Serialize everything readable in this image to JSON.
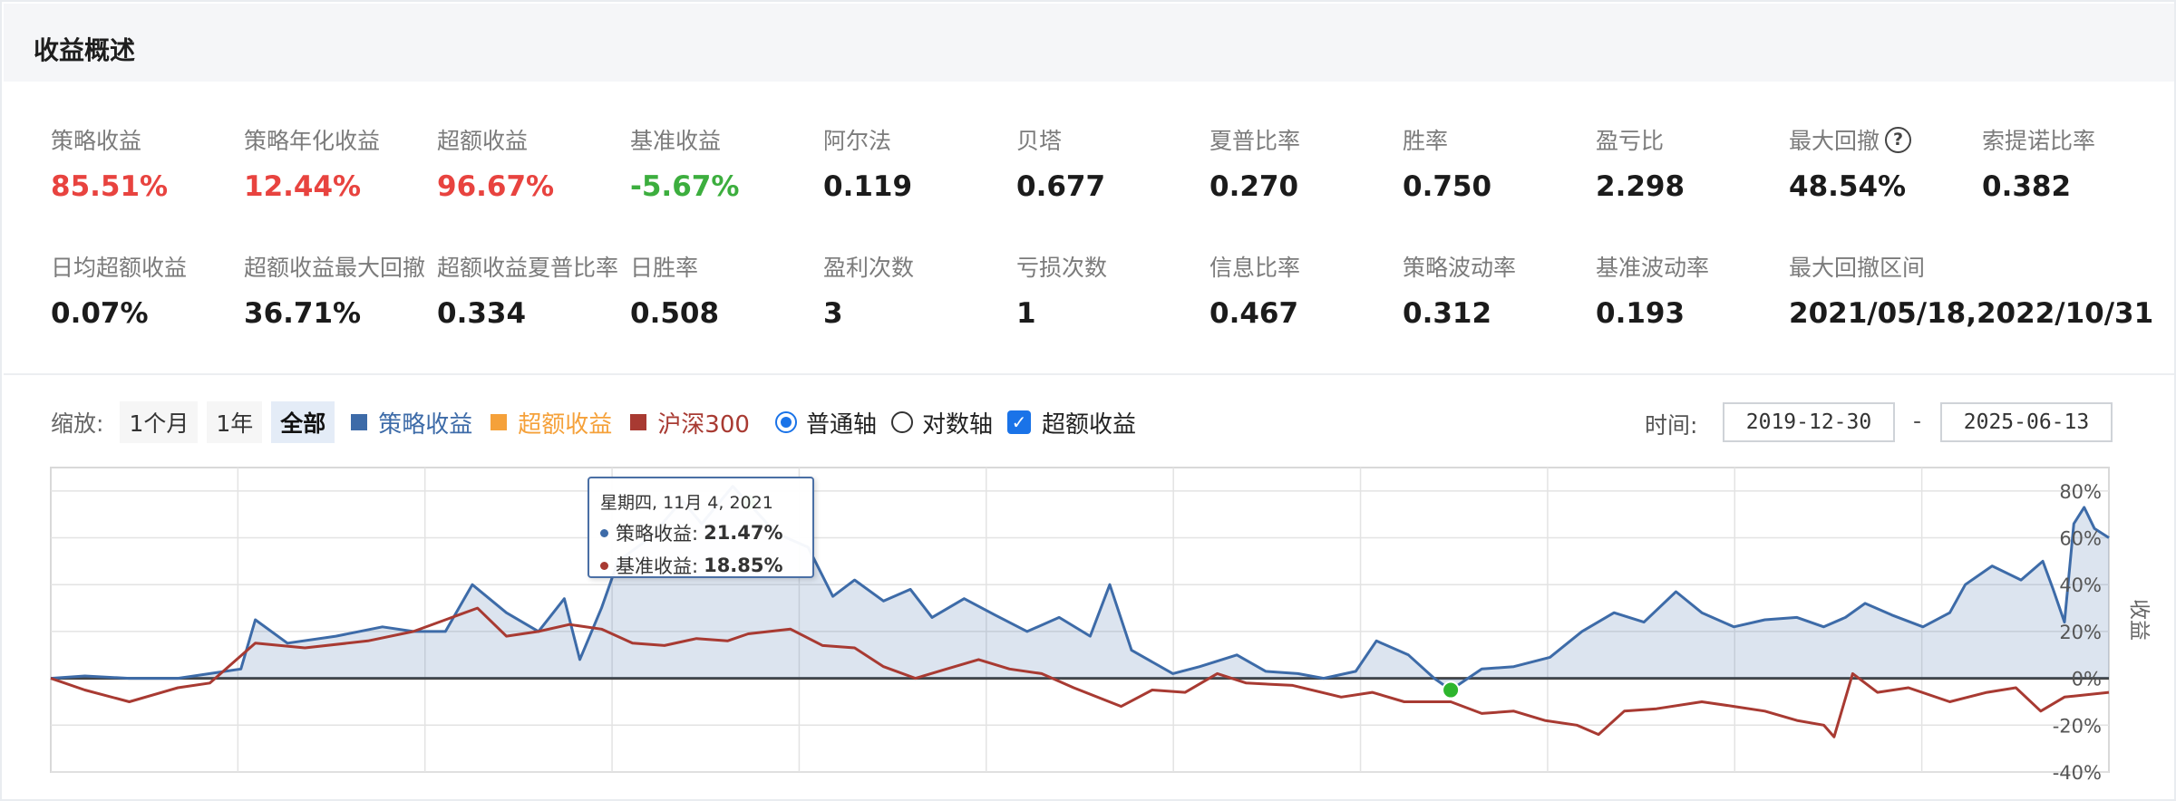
{
  "header": {
    "title": "收益概述"
  },
  "metrics": [
    {
      "label": "策略收益",
      "value": "85.51%"
    },
    {
      "label": "策略年化收益",
      "value": "12.44%"
    },
    {
      "label": "超额收益",
      "value": "96.67%"
    },
    {
      "label": "基准收益",
      "value": "-5.67%"
    },
    {
      "label": "阿尔法",
      "value": "0.119"
    },
    {
      "label": "贝塔",
      "value": "0.677"
    },
    {
      "label": "夏普比率",
      "value": "0.270"
    },
    {
      "label": "胜率",
      "value": "0.750"
    },
    {
      "label": "盈亏比",
      "value": "2.298"
    },
    {
      "label": "最大回撤",
      "value": "48.54%"
    },
    {
      "label": "索提诺比率",
      "value": "0.382"
    },
    {
      "label": "日均超额收益",
      "value": "0.07%"
    },
    {
      "label": "超额收益最大回撤",
      "value": "36.71%"
    },
    {
      "label": "超额收益夏普比率",
      "value": "0.334"
    },
    {
      "label": "日胜率",
      "value": "0.508"
    },
    {
      "label": "盈利次数",
      "value": "3"
    },
    {
      "label": "亏损次数",
      "value": "1"
    },
    {
      "label": "信息比率",
      "value": "0.467"
    },
    {
      "label": "策略波动率",
      "value": "0.312"
    },
    {
      "label": "基准波动率",
      "value": "0.193"
    },
    {
      "label": "最大回撤区间",
      "value": "2021/05/18,2022/10/31"
    }
  ],
  "help_icon_glyph": "?",
  "toolbar": {
    "zoom_label": "缩放:",
    "zoom_buttons": [
      "1个月",
      "1年",
      "全部"
    ],
    "legend": [
      {
        "label": "策略收益",
        "color": "#3d6ba8"
      },
      {
        "label": "超额收益",
        "color": "#f5a13a"
      },
      {
        "label": "沪深300",
        "color": "#a83a32"
      }
    ],
    "axis_normal": "普通轴",
    "axis_log": "对数轴",
    "excess_check": "超额收益",
    "check_glyph": "✓"
  },
  "time_range": {
    "label": "时间:",
    "start": "2019-12-30",
    "end": "2025-06-13",
    "dash": "-"
  },
  "tooltip": {
    "date": "星期四, 11月 4, 2021",
    "rows": [
      {
        "label": "策略收益:",
        "value": "21.47%",
        "color": "#3d6ba8"
      },
      {
        "label": "基准收益:",
        "value": "18.85%",
        "color": "#a83a32"
      }
    ]
  },
  "chart_data": {
    "type": "area",
    "y_axis_label": "收益",
    "ylim": [
      -40,
      90
    ],
    "yticks": [
      "80%",
      "60%",
      "40%",
      "20%",
      "0%",
      "-20%",
      "-40%"
    ],
    "ytick_values": [
      80,
      60,
      40,
      20,
      0,
      -20,
      -40
    ],
    "xlim": [
      "2019-12-30",
      "2025-06-13"
    ],
    "grid": true,
    "series": [
      {
        "name": "策略收益",
        "color": "#3d6ba8",
        "fill": "rgba(61,107,168,0.18)",
        "points": [
          [
            "2019-12-30",
            0
          ],
          [
            "2020-02-01",
            1
          ],
          [
            "2020-03-15",
            0
          ],
          [
            "2020-05-01",
            0
          ],
          [
            "2020-06-01",
            2
          ],
          [
            "2020-07-01",
            4
          ],
          [
            "2020-07-15",
            25
          ],
          [
            "2020-08-15",
            15
          ],
          [
            "2020-10-01",
            18
          ],
          [
            "2020-11-15",
            22
          ],
          [
            "2020-12-15",
            20
          ],
          [
            "2021-01-15",
            20
          ],
          [
            "2021-02-10",
            40
          ],
          [
            "2021-03-15",
            28
          ],
          [
            "2021-04-15",
            20
          ],
          [
            "2021-05-10",
            34
          ],
          [
            "2021-05-25",
            8
          ],
          [
            "2021-06-15",
            30
          ],
          [
            "2021-07-01",
            50
          ],
          [
            "2021-08-01",
            60
          ],
          [
            "2021-09-01",
            76
          ],
          [
            "2021-09-20",
            66
          ],
          [
            "2021-10-20",
            82
          ],
          [
            "2021-11-04",
            75
          ],
          [
            "2021-12-01",
            62
          ],
          [
            "2022-01-01",
            56
          ],
          [
            "2022-01-25",
            35
          ],
          [
            "2022-02-15",
            42
          ],
          [
            "2022-03-15",
            33
          ],
          [
            "2022-04-10",
            38
          ],
          [
            "2022-05-01",
            26
          ],
          [
            "2022-06-01",
            34
          ],
          [
            "2022-07-01",
            27
          ],
          [
            "2022-08-01",
            20
          ],
          [
            "2022-09-01",
            26
          ],
          [
            "2022-10-01",
            18
          ],
          [
            "2022-10-20",
            40
          ],
          [
            "2022-11-10",
            12
          ],
          [
            "2022-12-20",
            2
          ],
          [
            "2023-01-15",
            5
          ],
          [
            "2023-02-20",
            10
          ],
          [
            "2023-03-20",
            3
          ],
          [
            "2023-04-20",
            2
          ],
          [
            "2023-05-15",
            0
          ],
          [
            "2023-06-15",
            3
          ],
          [
            "2023-07-05",
            16
          ],
          [
            "2023-08-05",
            10
          ],
          [
            "2023-08-30",
            0
          ],
          [
            "2023-09-15",
            -5
          ],
          [
            "2023-10-15",
            4
          ],
          [
            "2023-11-15",
            5
          ],
          [
            "2023-12-20",
            9
          ],
          [
            "2024-01-20",
            20
          ],
          [
            "2024-02-20",
            28
          ],
          [
            "2024-03-20",
            24
          ],
          [
            "2024-04-20",
            37
          ],
          [
            "2024-05-15",
            28
          ],
          [
            "2024-06-15",
            22
          ],
          [
            "2024-07-15",
            25
          ],
          [
            "2024-08-15",
            26
          ],
          [
            "2024-09-10",
            22
          ],
          [
            "2024-10-01",
            26
          ],
          [
            "2024-10-20",
            32
          ],
          [
            "2024-11-15",
            27
          ],
          [
            "2024-12-15",
            22
          ],
          [
            "2025-01-10",
            28
          ],
          [
            "2025-01-25",
            40
          ],
          [
            "2025-02-20",
            48
          ],
          [
            "2025-03-20",
            42
          ],
          [
            "2025-04-10",
            50
          ],
          [
            "2025-04-20",
            38
          ],
          [
            "2025-05-01",
            24
          ],
          [
            "2025-05-10",
            66
          ],
          [
            "2025-05-20",
            73
          ],
          [
            "2025-05-30",
            64
          ],
          [
            "2025-06-13",
            60
          ]
        ]
      },
      {
        "name": "沪深300",
        "color": "#a83a32",
        "points": [
          [
            "2019-12-30",
            0
          ],
          [
            "2020-02-01",
            -5
          ],
          [
            "2020-03-15",
            -10
          ],
          [
            "2020-05-01",
            -4
          ],
          [
            "2020-06-01",
            -2
          ],
          [
            "2020-07-15",
            15
          ],
          [
            "2020-09-01",
            13
          ],
          [
            "2020-11-01",
            16
          ],
          [
            "2020-12-15",
            20
          ],
          [
            "2021-01-15",
            25
          ],
          [
            "2021-02-15",
            30
          ],
          [
            "2021-03-15",
            18
          ],
          [
            "2021-04-15",
            20
          ],
          [
            "2021-05-15",
            23
          ],
          [
            "2021-06-15",
            21
          ],
          [
            "2021-07-15",
            15
          ],
          [
            "2021-08-15",
            14
          ],
          [
            "2021-09-15",
            17
          ],
          [
            "2021-10-15",
            16
          ],
          [
            "2021-11-04",
            19
          ],
          [
            "2021-12-15",
            21
          ],
          [
            "2022-01-15",
            14
          ],
          [
            "2022-02-15",
            13
          ],
          [
            "2022-03-15",
            5
          ],
          [
            "2022-04-15",
            0
          ],
          [
            "2022-05-15",
            4
          ],
          [
            "2022-06-15",
            8
          ],
          [
            "2022-07-15",
            4
          ],
          [
            "2022-08-15",
            2
          ],
          [
            "2022-09-15",
            -4
          ],
          [
            "2022-10-31",
            -12
          ],
          [
            "2022-11-30",
            -5
          ],
          [
            "2023-01-01",
            -6
          ],
          [
            "2023-02-01",
            2
          ],
          [
            "2023-03-01",
            -2
          ],
          [
            "2023-04-15",
            -3
          ],
          [
            "2023-06-01",
            -8
          ],
          [
            "2023-07-01",
            -6
          ],
          [
            "2023-08-01",
            -10
          ],
          [
            "2023-09-15",
            -10
          ],
          [
            "2023-10-15",
            -15
          ],
          [
            "2023-11-15",
            -14
          ],
          [
            "2023-12-15",
            -18
          ],
          [
            "2024-01-15",
            -20
          ],
          [
            "2024-02-05",
            -24
          ],
          [
            "2024-03-01",
            -14
          ],
          [
            "2024-04-01",
            -13
          ],
          [
            "2024-05-15",
            -10
          ],
          [
            "2024-06-15",
            -12
          ],
          [
            "2024-07-15",
            -14
          ],
          [
            "2024-08-15",
            -18
          ],
          [
            "2024-09-10",
            -20
          ],
          [
            "2024-09-20",
            -25
          ],
          [
            "2024-10-08",
            2
          ],
          [
            "2024-11-01",
            -6
          ],
          [
            "2024-12-01",
            -4
          ],
          [
            "2025-01-10",
            -10
          ],
          [
            "2025-02-15",
            -6
          ],
          [
            "2025-03-15",
            -4
          ],
          [
            "2025-04-08",
            -14
          ],
          [
            "2025-05-01",
            -8
          ],
          [
            "2025-06-13",
            -6
          ]
        ]
      }
    ],
    "highlight_points": [
      {
        "series": "策略收益",
        "date": "2021-11-04",
        "value": 75
      },
      {
        "series": "沪深300",
        "date": "2023-09-15",
        "value": -5
      }
    ]
  }
}
